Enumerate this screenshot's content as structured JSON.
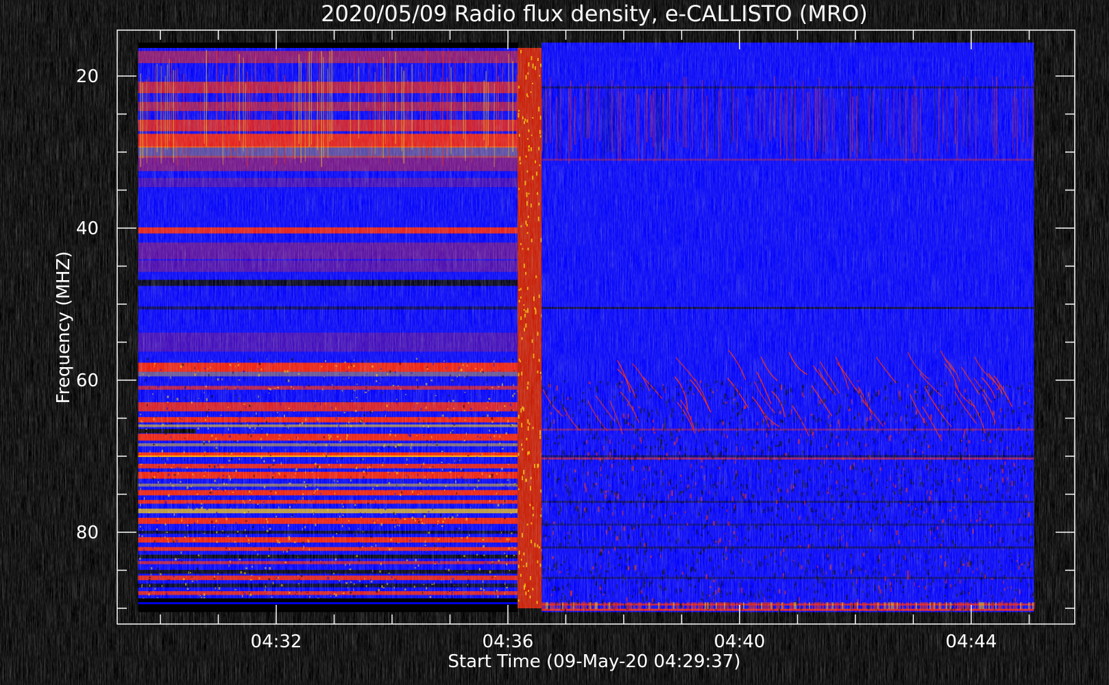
{
  "chart_data": {
    "type": "heatmap",
    "title": "2020/05/09  Radio flux density, e-CALLISTO (MRO)",
    "xlabel": "Start Time (09-May-20 04:29:37)",
    "ylabel": "Frequency (MHZ)",
    "x_start_time": "04:29:37",
    "x_ticks": [
      "04:32",
      "04:36",
      "04:40",
      "04:44"
    ],
    "y_ticks": [
      20,
      40,
      60,
      80
    ],
    "ylim": [
      91,
      14
    ],
    "colormap": [
      "#000000",
      "#0000ff",
      "#ff2000",
      "#ffd000"
    ],
    "segments": [
      {
        "start": "04:29:37",
        "end": "04:36:10",
        "freq_range": [
          88.7,
          16.3
        ],
        "dominant": "red bands"
      },
      {
        "start": "04:36:10",
        "end": "04:36:35",
        "freq_range": [
          90.0,
          16.3
        ],
        "dominant": "bright vertical stripe"
      },
      {
        "start": "04:36:35",
        "end": "04:45:05",
        "freq_range": [
          90.5,
          15.6
        ],
        "dominant": "blue"
      }
    ]
  }
}
